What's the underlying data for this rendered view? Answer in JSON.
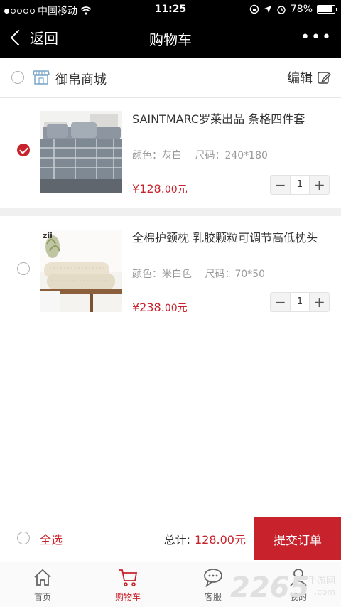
{
  "status": {
    "carrier": "中国移动",
    "time": "11:25",
    "battery": "78%",
    "battery_level": 0.78
  },
  "nav": {
    "back_label": "返回",
    "title": "购物车",
    "more_glyph": "•••"
  },
  "store": {
    "name": "御帛商城",
    "edit_label": "编辑"
  },
  "items": [
    {
      "name": "SAINTMARC罗莱出品 条格四件套",
      "color_label": "颜色：灰白",
      "size_label": "尺码：240*180",
      "price_prefix": "¥128.",
      "price_suffix": "00元",
      "qty": "1",
      "checked": true
    },
    {
      "name": "全棉护颈枕 乳胶颗粒可调节高低枕头",
      "color_label": "颜色：米白色",
      "size_label": "尺码：70*50",
      "price_prefix": "¥238.",
      "price_suffix": "00元",
      "qty": "1",
      "checked": false,
      "thumb_tag": "zii"
    }
  ],
  "checkout": {
    "select_all": "全选",
    "total_label": "总计:",
    "total_value": "128.00元",
    "submit_label": "提交订单"
  },
  "tabs": [
    {
      "label": "首页",
      "icon": "home-icon"
    },
    {
      "label": "购物车",
      "icon": "cart-icon"
    },
    {
      "label": "客服",
      "icon": "chat-icon"
    },
    {
      "label": "我的",
      "icon": "user-icon"
    }
  ],
  "watermark": {
    "text": "2265",
    "suffix": ".com",
    "sub": "手游网"
  },
  "colors": {
    "accent": "#c8232c",
    "topbar": "#000000"
  }
}
